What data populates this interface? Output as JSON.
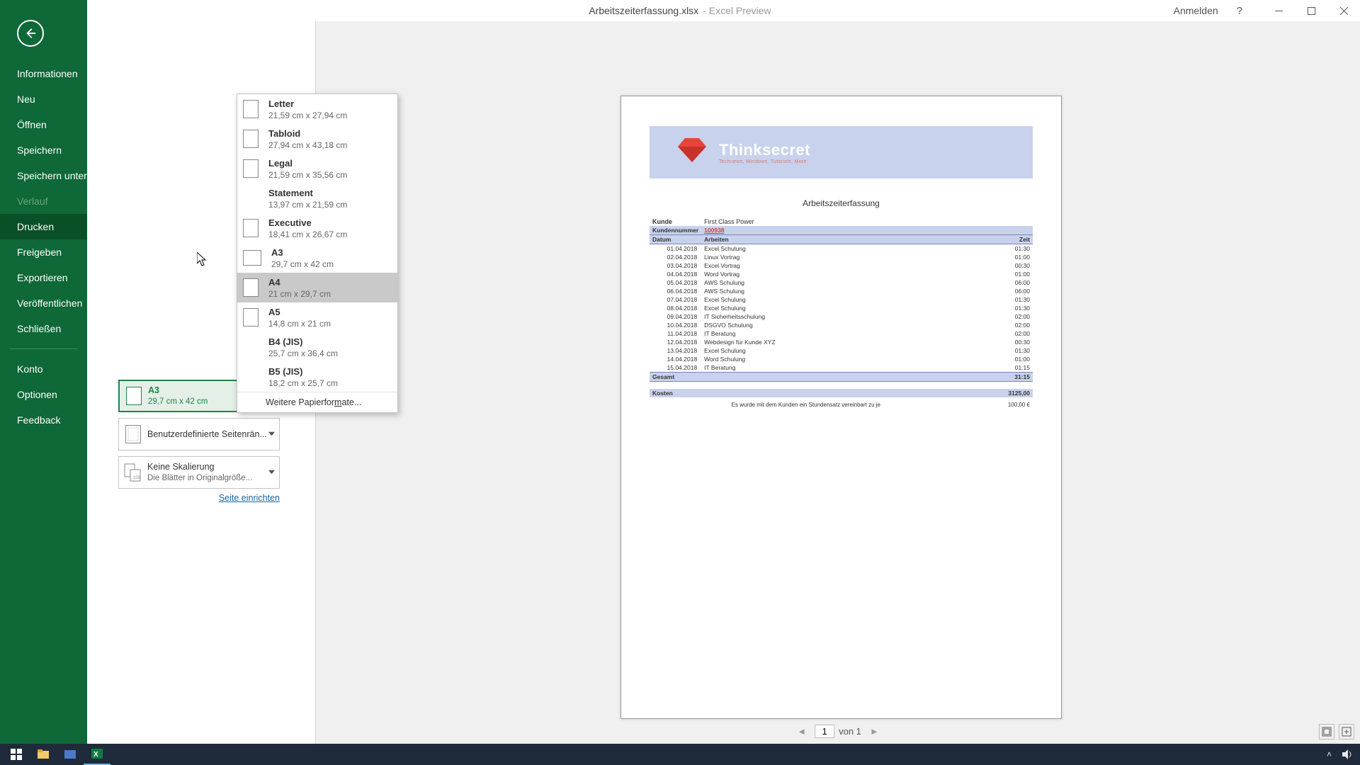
{
  "titlebar": {
    "filename": "Arbeitszeiterfassung.xlsx",
    "suffix": "- Excel Preview",
    "login": "Anmelden",
    "help": "?"
  },
  "sidebar": {
    "items": [
      {
        "label": "Informationen",
        "active": false,
        "disabled": false
      },
      {
        "label": "Neu",
        "active": false,
        "disabled": false
      },
      {
        "label": "Öffnen",
        "active": false,
        "disabled": false
      },
      {
        "label": "Speichern",
        "active": false,
        "disabled": false
      },
      {
        "label": "Speichern unter",
        "active": false,
        "disabled": false
      },
      {
        "label": "Verlauf",
        "active": false,
        "disabled": true
      },
      {
        "label": "Drucken",
        "active": true,
        "disabled": false
      },
      {
        "label": "Freigeben",
        "active": false,
        "disabled": false
      },
      {
        "label": "Exportieren",
        "active": false,
        "disabled": false
      },
      {
        "label": "Veröffentlichen",
        "active": false,
        "disabled": false
      },
      {
        "label": "Schließen",
        "active": false,
        "disabled": false
      }
    ],
    "bottom": [
      {
        "label": "Konto"
      },
      {
        "label": "Optionen"
      },
      {
        "label": "Feedback"
      }
    ]
  },
  "paper_dropdown": {
    "options": [
      {
        "name": "Letter",
        "dim": "21,59 cm x 27,94 cm",
        "icon": "portrait"
      },
      {
        "name": "Tabloid",
        "dim": "27,94 cm x 43,18 cm",
        "icon": "portrait"
      },
      {
        "name": "Legal",
        "dim": "21,59 cm x 35,56 cm",
        "icon": "portrait"
      },
      {
        "name": "Statement",
        "dim": "13,97 cm x 21,59 cm",
        "icon": "none"
      },
      {
        "name": "Executive",
        "dim": "18,41 cm x 26,67 cm",
        "icon": "portrait"
      },
      {
        "name": "A3",
        "dim": "29,7 cm x 42 cm",
        "icon": "wide"
      },
      {
        "name": "A4",
        "dim": "21 cm x 29,7 cm",
        "icon": "portrait",
        "highlight": true
      },
      {
        "name": "A5",
        "dim": "14,8 cm x 21 cm",
        "icon": "portrait"
      },
      {
        "name": "B4 (JIS)",
        "dim": "25,7 cm x 36,4 cm",
        "icon": "none"
      },
      {
        "name": "B5 (JIS)",
        "dim": "18,2 cm x 25,7 cm",
        "icon": "none"
      }
    ],
    "more": "Weitere Papierformate..."
  },
  "settings": {
    "paper_selected": {
      "name": "A3",
      "dim": "29,7 cm x 42 cm"
    },
    "margins": {
      "label": "Benutzerdefinierte Seitenrän..."
    },
    "scaling": {
      "label": "Keine Skalierung",
      "sub": "Die Blätter in Originalgröße..."
    },
    "page_setup_link": "Seite einrichten"
  },
  "preview": {
    "doc_title": "Arbeitszeiterfassung",
    "logo_text": "Thinksecret",
    "logo_sub": "Technews, Windows, Tutorials, More",
    "kunde_label": "Kunde",
    "kunde_value": "First Class Power",
    "kundennr_label": "Kundennummer",
    "kundennr_value": "100938",
    "col_date": "Datum",
    "col_work": "Arbeiten",
    "col_time": "Zeit",
    "rows": [
      {
        "d": "01.04.2018",
        "w": "Excel Schulung",
        "t": "01:30"
      },
      {
        "d": "02.04.2018",
        "w": "Linux Vortrag",
        "t": "01:00"
      },
      {
        "d": "03.04.2018",
        "w": "Excel Vortrag",
        "t": "00:30"
      },
      {
        "d": "04.04.2018",
        "w": "Word Vortrag",
        "t": "01:00"
      },
      {
        "d": "05.04.2018",
        "w": "AWS Schulung",
        "t": "06:00"
      },
      {
        "d": "06.04.2018",
        "w": "AWS Schulung",
        "t": "06:00"
      },
      {
        "d": "07.04.2018",
        "w": "Excel Schulung",
        "t": "01:30"
      },
      {
        "d": "08.04.2018",
        "w": "Excel Schulung",
        "t": "01:30"
      },
      {
        "d": "09.04.2018",
        "w": "IT Sicherheitsschulung",
        "t": "02:00"
      },
      {
        "d": "10.04.2018",
        "w": "DSGVO Schulung",
        "t": "02:00"
      },
      {
        "d": "11.04.2018",
        "w": "IT Beratung",
        "t": "02:00"
      },
      {
        "d": "12.04.2018",
        "w": "Webdesign für Kunde XYZ",
        "t": "00:30"
      },
      {
        "d": "13.04.2018",
        "w": "Excel Schulung",
        "t": "01:30"
      },
      {
        "d": "14.04.2018",
        "w": "Word Schulung",
        "t": "01:00"
      },
      {
        "d": "15.04.2018",
        "w": "IT Beratung",
        "t": "01:15"
      }
    ],
    "total_label": "Gesamt",
    "total_value": "31:15",
    "cost_label": "Kosten",
    "cost_value": "3125,00",
    "note": "Es wurde mit dem Kunden ein Stundensatz vereinbart zu je",
    "note_rate": "100,00 €"
  },
  "pagenav": {
    "current": "1",
    "of_label": "von 1"
  }
}
